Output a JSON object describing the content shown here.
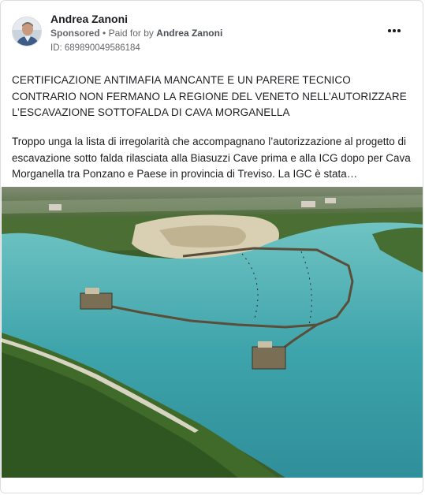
{
  "post": {
    "author": "Andrea Zanoni",
    "sponsored_label": "Sponsored",
    "separator": "•",
    "paid_for_prefix": "Paid for by",
    "payer": "Andrea Zanoni",
    "ad_id": "ID: 689890049586184",
    "headline": "CERTIFICAZIONE ANTIMAFIA MANCANTE E UN PARERE TECNICO CONTRARIO NON FERMANO LA REGIONE DEL VENETO NELL’AUTORIZZARE L’ESCAVAZIONE SOTTOFALDA DI CAVA MORGANELLA",
    "body": "Troppo unga la lista di irregolarità che accompagnano l’autorizzazione al progetto di escavazione sotto falda rilasciata alla Biasuzzi Cave prima e alla ICG dopo per Cava Morganella tra Ponzano e Paese in provincia di Treviso. La IGC è stata…",
    "image_icon": "aerial-photo-quarry-lake"
  },
  "colors": {
    "text_primary": "#1c1e21",
    "text_secondary": "#65676b",
    "border": "#dadde1",
    "lake": "#3fa6ac"
  }
}
